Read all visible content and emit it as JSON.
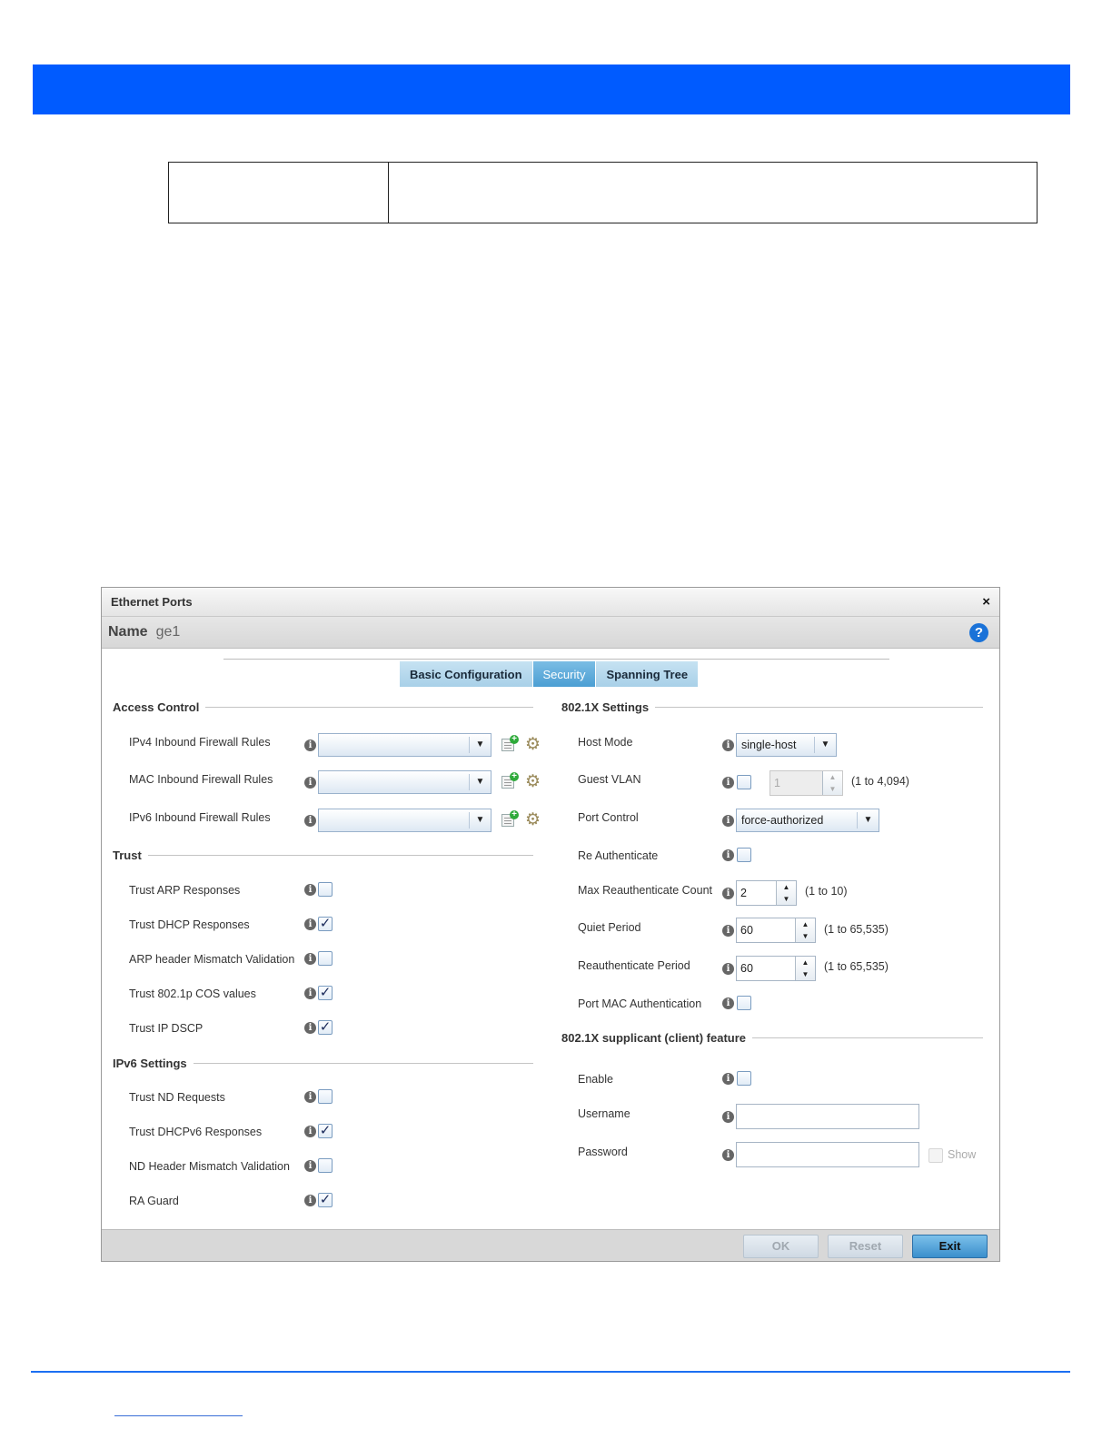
{
  "dialog": {
    "title": "Ethernet Ports",
    "close_glyph": "×",
    "name_label": "Name",
    "name_value": "ge1",
    "help_glyph": "?"
  },
  "tabs": [
    {
      "label": "Basic Configuration",
      "active": false
    },
    {
      "label": "Security",
      "active": true
    },
    {
      "label": "Spanning Tree",
      "active": false
    }
  ],
  "access_control": {
    "heading": "Access Control",
    "rows": [
      {
        "label": "IPv4 Inbound Firewall Rules",
        "value": ""
      },
      {
        "label": "MAC Inbound Firewall Rules",
        "value": ""
      },
      {
        "label": "IPv6 Inbound Firewall Rules",
        "value": ""
      }
    ]
  },
  "trust": {
    "heading": "Trust",
    "rows": [
      {
        "label": "Trust ARP Responses",
        "checked": false
      },
      {
        "label": "Trust DHCP Responses",
        "checked": true
      },
      {
        "label": "ARP header Mismatch Validation",
        "checked": false
      },
      {
        "label": "Trust 802.1p COS values",
        "checked": true
      },
      {
        "label": "Trust IP DSCP",
        "checked": true
      }
    ]
  },
  "ipv6": {
    "heading": "IPv6 Settings",
    "rows": [
      {
        "label": "Trust ND Requests",
        "checked": false
      },
      {
        "label": "Trust DHCPv6 Responses",
        "checked": true
      },
      {
        "label": "ND Header Mismatch Validation",
        "checked": false
      },
      {
        "label": "RA Guard",
        "checked": true
      }
    ]
  },
  "dot1x": {
    "heading": "802.1X Settings",
    "host_mode": {
      "label": "Host Mode",
      "value": "single-host"
    },
    "guest_vlan": {
      "label": "Guest VLAN",
      "checked": false,
      "value": "1",
      "range": "(1 to 4,094)"
    },
    "port_control": {
      "label": "Port Control",
      "value": "force-authorized"
    },
    "re_auth": {
      "label": "Re Authenticate",
      "checked": false
    },
    "max_reauth": {
      "label": "Max Reauthenticate Count",
      "value": "2",
      "range": "(1 to 10)"
    },
    "quiet": {
      "label": "Quiet Period",
      "value": "60",
      "range": "(1 to 65,535)"
    },
    "reauth_period": {
      "label": "Reauthenticate Period",
      "value": "60",
      "range": "(1 to 65,535)"
    },
    "port_mac": {
      "label": "Port MAC Authentication",
      "checked": false
    }
  },
  "supplicant": {
    "heading": "802.1X supplicant (client) feature",
    "enable": {
      "label": "Enable",
      "checked": false
    },
    "username": {
      "label": "Username",
      "value": ""
    },
    "password": {
      "label": "Password",
      "value": ""
    },
    "show_label": "Show"
  },
  "footer": {
    "ok": "OK",
    "reset": "Reset",
    "exit": "Exit"
  },
  "icons": {
    "info": "i",
    "check": "✓",
    "dropdown": "▼",
    "spin_up": "▲",
    "spin_down": "▼",
    "gear": "⚙",
    "plus": "+"
  }
}
